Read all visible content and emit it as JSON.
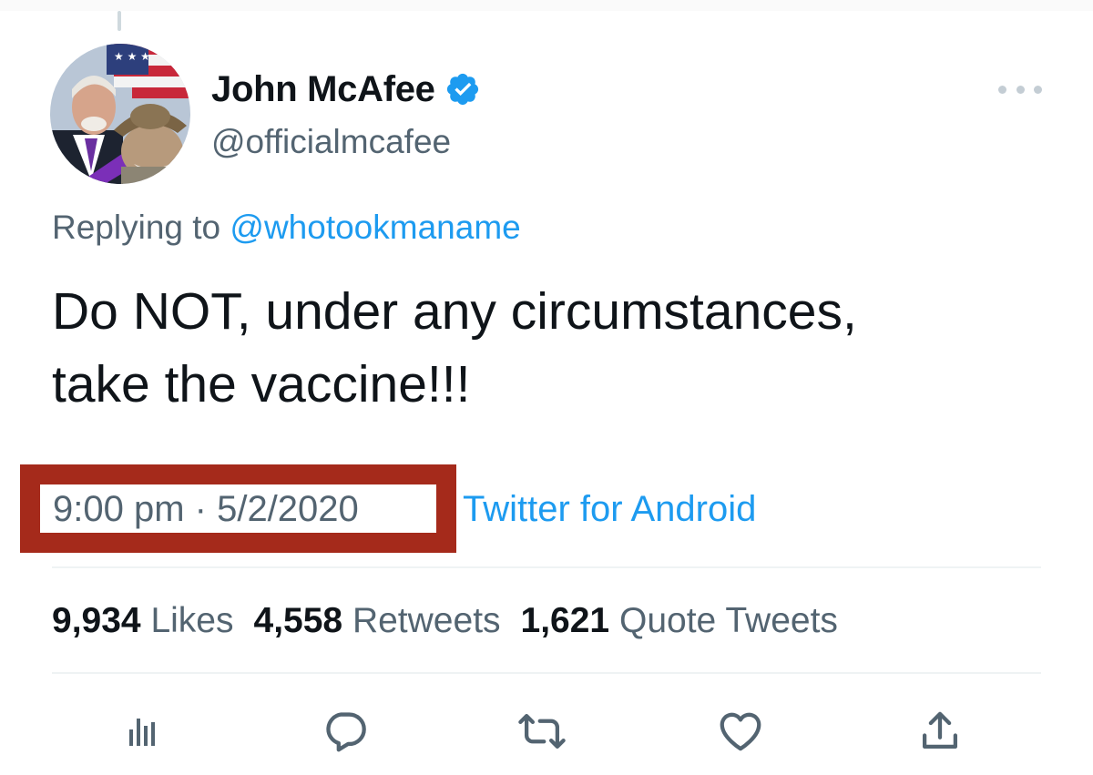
{
  "tweet": {
    "display_name": "John McAfee",
    "handle": "@officialmcafee",
    "replying_prefix": "Replying to",
    "replying_mention": "@whotookmaname",
    "text_lines": [
      "Do NOT, under any circumstances,",
      "take the vaccine!!!"
    ],
    "timestamp": "9:00 pm · 5/2/2020",
    "source": "Twitter for Android"
  },
  "stats": {
    "likes_count": "9,934",
    "likes_label": "Likes",
    "retweets_count": "4,558",
    "retweets_label": "Retweets",
    "quotes_count": "1,621",
    "quotes_label": "Quote Tweets"
  },
  "icons": {
    "verified": "verified-badge-icon",
    "more": "more-options-icon",
    "analytics": "analytics-icon",
    "reply": "reply-icon",
    "retweet": "retweet-icon",
    "like": "heart-icon",
    "share": "share-icon"
  },
  "colors": {
    "accent": "#1d9bf0",
    "secondary_text": "#536471",
    "highlight_box": "#a52a1b"
  }
}
